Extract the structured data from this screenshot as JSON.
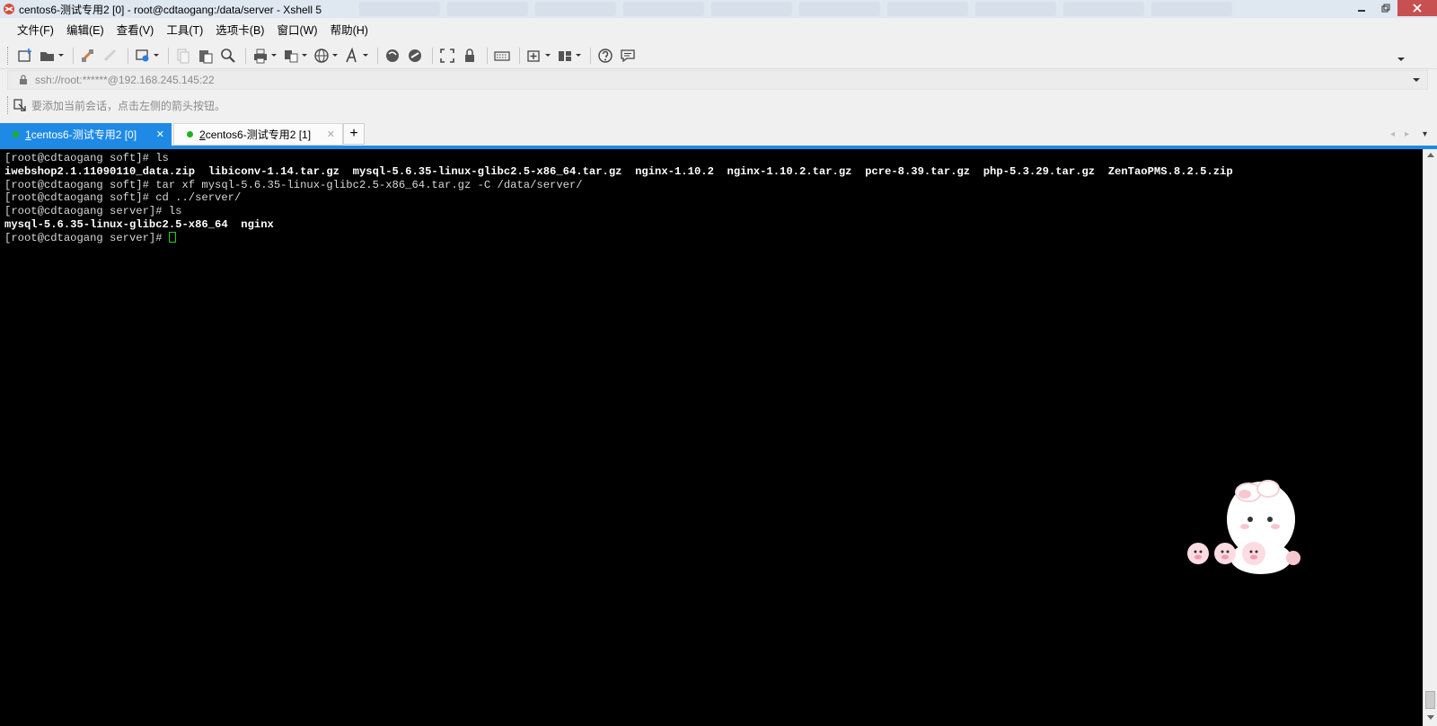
{
  "window": {
    "title": "centos6-测试专用2 [0] - root@cdtaogang:/data/server - Xshell 5"
  },
  "menu": [
    {
      "label": "文件(F)"
    },
    {
      "label": "编辑(E)"
    },
    {
      "label": "查看(V)"
    },
    {
      "label": "工具(T)"
    },
    {
      "label": "选项卡(B)"
    },
    {
      "label": "窗口(W)"
    },
    {
      "label": "帮助(H)"
    }
  ],
  "address": {
    "value": "ssh://root:******@192.168.245.145:22"
  },
  "hint": {
    "text": "要添加当前会话，点击左侧的箭头按钮。"
  },
  "tabs": [
    {
      "number": "1",
      "label": " centos6-测试专用2 [0]",
      "active": true
    },
    {
      "number": "2",
      "label": " centos6-测试专用2 [1]",
      "active": false
    }
  ],
  "terminal": {
    "lines": [
      {
        "text": "[root@cdtaogang soft]# ls",
        "bold": false
      },
      {
        "text": "iwebshop2.1.11090110_data.zip  libiconv-1.14.tar.gz  mysql-5.6.35-linux-glibc2.5-x86_64.tar.gz  nginx-1.10.2  nginx-1.10.2.tar.gz  pcre-8.39.tar.gz  php-5.3.29.tar.gz  ZenTaoPMS.8.2.5.zip",
        "bold": true
      },
      {
        "text": "[root@cdtaogang soft]# tar xf mysql-5.6.35-linux-glibc2.5-x86_64.tar.gz -C /data/server/",
        "bold": false
      },
      {
        "text": "[root@cdtaogang soft]# cd ../server/",
        "bold": false
      },
      {
        "text": "[root@cdtaogang server]# ls",
        "bold": false
      },
      {
        "text": "mysql-5.6.35-linux-glibc2.5-x86_64  nginx",
        "bold": true
      },
      {
        "text": "[root@cdtaogang server]# ",
        "bold": false,
        "cursor": true
      }
    ]
  },
  "icons": {
    "toolbar": [
      "new-session-icon",
      "open-folder-icon",
      "reconnect-icon",
      "disconnect-icon",
      "properties-icon",
      "copy-icon",
      "paste-icon",
      "find-icon",
      "print-icon",
      "transfer-icon",
      "globe-icon",
      "font-icon",
      "xftp-icon",
      "script-icon",
      "fullscreen-icon",
      "lock-icon",
      "keyboard-icon",
      "add-tab-icon",
      "layout-icon",
      "help-icon",
      "chat-icon"
    ]
  },
  "colors": {
    "tab_active": "#1e8ae6",
    "session_dot": "#1db21d",
    "terminal_bg": "#000000",
    "cursor": "#1fd11f"
  }
}
